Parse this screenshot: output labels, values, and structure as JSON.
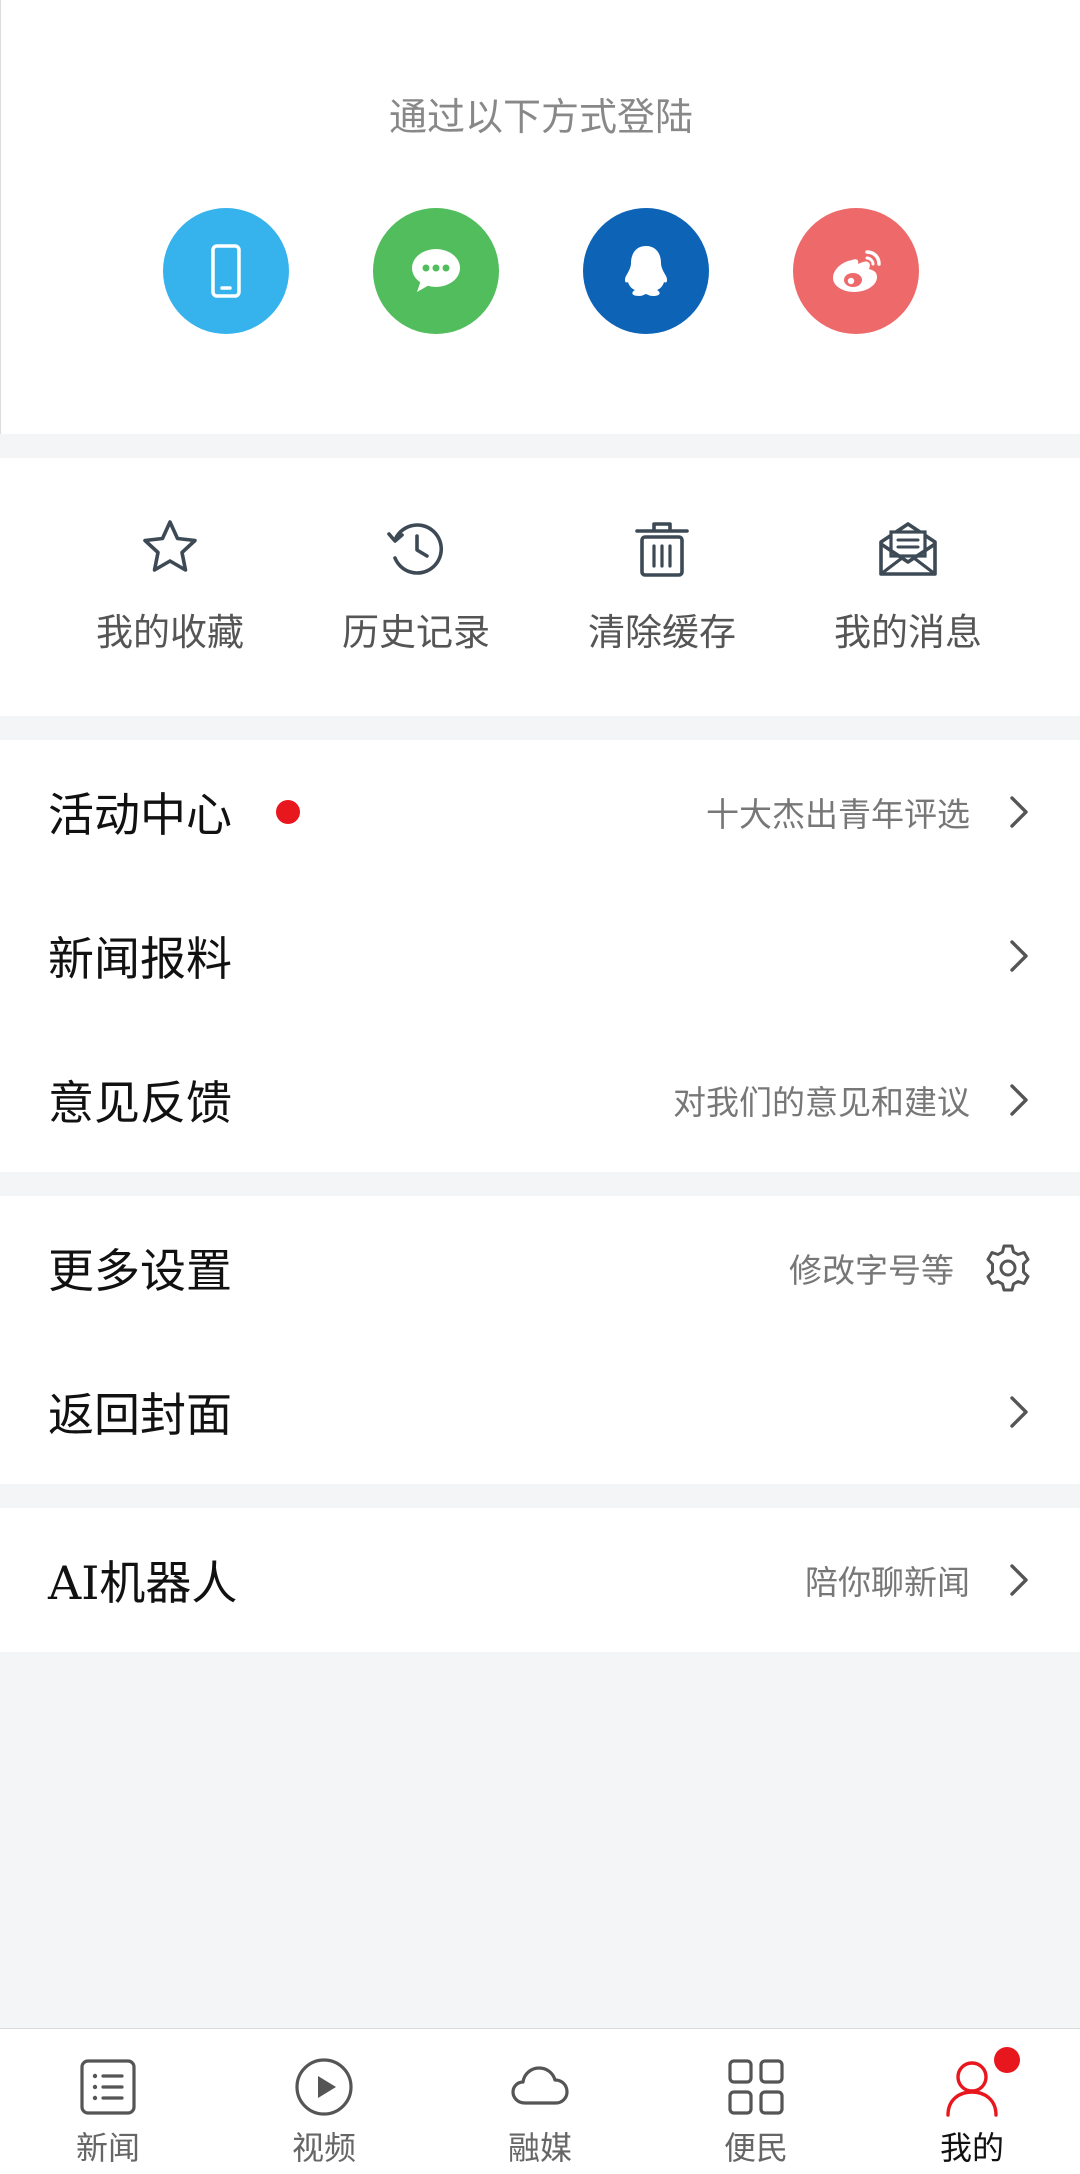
{
  "login": {
    "title": "通过以下方式登陆",
    "methods": [
      {
        "icon": "phone-icon",
        "color": "#36b3ec"
      },
      {
        "icon": "wechat-icon",
        "color": "#52bd5c"
      },
      {
        "icon": "qq-icon",
        "color": "#0d64b6"
      },
      {
        "icon": "weibo-icon",
        "color": "#ee6a6a"
      }
    ]
  },
  "quick_actions": [
    {
      "label": "我的收藏",
      "icon": "star-icon"
    },
    {
      "label": "历史记录",
      "icon": "history-icon"
    },
    {
      "label": "清除缓存",
      "icon": "trash-icon"
    },
    {
      "label": "我的消息",
      "icon": "mail-icon"
    }
  ],
  "menu": {
    "activity": {
      "title": "活动中心",
      "subtitle": "十大杰出青年评选",
      "has_dot": true
    },
    "news_tip": {
      "title": "新闻报料"
    },
    "feedback": {
      "title": "意见反馈",
      "subtitle": "对我们的意见和建议"
    },
    "settings": {
      "title": "更多设置",
      "subtitle": "修改字号等"
    },
    "cover": {
      "title": "返回封面"
    },
    "ai_robot": {
      "title": "AI机器人",
      "subtitle": "陪你聊新闻"
    }
  },
  "tabbar": {
    "tabs": [
      {
        "label": "新闻",
        "icon": "news-list-icon"
      },
      {
        "label": "视频",
        "icon": "play-icon"
      },
      {
        "label": "融媒",
        "icon": "cloud-icon"
      },
      {
        "label": "便民",
        "icon": "grid-icon"
      },
      {
        "label": "我的",
        "icon": "user-icon",
        "active": true,
        "has_badge": true
      }
    ]
  },
  "colors": {
    "accent_red": "#e8161d",
    "icon_gray": "#3d4a55",
    "background": "#f4f5f7"
  }
}
